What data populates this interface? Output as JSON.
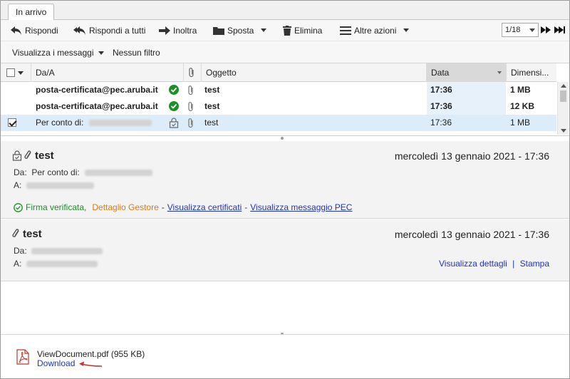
{
  "tab": {
    "label": "In arrivo"
  },
  "toolbar": {
    "reply": "Rispondi",
    "reply_all": "Rispondi a tutti",
    "forward": "Inoltra",
    "move": "Sposta",
    "delete": "Elimina",
    "more": "Altre azioni",
    "page": "1/18"
  },
  "viewbar": {
    "view_messages": "Visualizza i messaggi",
    "filter": "Nessun filtro"
  },
  "list": {
    "columns": {
      "from": "Da/A",
      "subject": "Oggetto",
      "date": "Data",
      "size": "Dimensi..."
    },
    "rows": [
      {
        "from": "posta-certificata@pec.aruba.it",
        "subject": "test",
        "date": "17:36",
        "size": "1 MB",
        "status": "verified",
        "checked": false,
        "unread": true
      },
      {
        "from": "posta-certificata@pec.aruba.it",
        "subject": "test",
        "date": "17:36",
        "size": "12 KB",
        "status": "verified",
        "checked": false,
        "unread": true
      },
      {
        "from": "Per conto di:",
        "subject": "test",
        "date": "17:36",
        "size": "1 MB",
        "status": "lock",
        "checked": true,
        "unread": false
      }
    ]
  },
  "message1": {
    "subject": "test",
    "date": "mercoledì 13 gennaio 2021 - 17:36",
    "from_label": "Da:",
    "from_value": "Per conto di:",
    "to_label": "A:",
    "signature_status": "Firma verificata,",
    "provider_detail": "Dettaglio Gestore",
    "sep1": "-",
    "view_certs": "Visualizza certificati",
    "sep2": "-",
    "view_pec": "Visualizza messaggio PEC"
  },
  "message2": {
    "subject": "test",
    "date": "mercoledì 13 gennaio 2021 - 17:36",
    "from_label": "Da:",
    "to_label": "A:",
    "view_details": "Visualizza dettagli",
    "sep": "|",
    "print": "Stampa"
  },
  "attachment": {
    "filename": "ViewDocument.pdf",
    "size": "(955 KB)",
    "download": "Download"
  },
  "colors": {
    "link": "#1f33c7",
    "verified": "#1d8f2a",
    "orange": "#e07b12",
    "arrow": "#c8312c",
    "selected_row": "#dcecf8"
  }
}
